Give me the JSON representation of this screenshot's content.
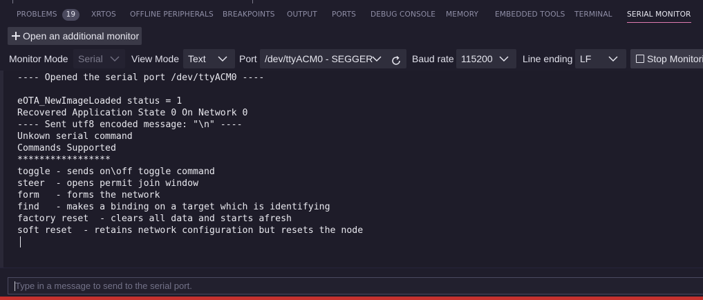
{
  "tabs": [
    {
      "label": "PROBLEMS",
      "badge": "19"
    },
    {
      "label": "XRTOS"
    },
    {
      "label": "OFFLINE PERIPHERALS"
    },
    {
      "label": "BREAKPOINTS"
    },
    {
      "label": "OUTPUT"
    },
    {
      "label": "PORTS"
    },
    {
      "label": "DEBUG CONSOLE"
    },
    {
      "label": "MEMORY"
    },
    {
      "label": "EMBEDDED TOOLS"
    },
    {
      "label": "TERMINAL"
    },
    {
      "label": "SERIAL MONITOR",
      "active": true
    }
  ],
  "open_monitor_label": "Open an additional monitor",
  "controls": {
    "monitor_mode_label": "Monitor Mode",
    "monitor_mode_value": "Serial",
    "view_mode_label": "View Mode",
    "view_mode_value": "Text",
    "port_label": "Port",
    "port_value": "/dev/ttyACM0 - SEGGER",
    "baud_rate_label": "Baud rate",
    "baud_rate_value": "115200",
    "line_ending_label": "Line ending",
    "line_ending_value": "LF",
    "stop_label": "Stop Monitoring"
  },
  "output_lines": [
    "---- Opened the serial port /dev/ttyACM0 ----",
    "",
    "eOTA_NewImageLoaded status = 1",
    "Recovered Application State 0 On Network 0",
    "---- Sent utf8 encoded message: \"\\n\" ----",
    "Unkown serial command",
    "Commands Supported",
    "*****************",
    "toggle - sends on\\off toggle command",
    "steer  - opens permit join window",
    "form   - forms the network",
    "find   - makes a binding on a target which is identifying",
    "factory reset  - clears all data and starts afresh",
    "soft reset  - retains network configuration but resets the node"
  ],
  "message_input": {
    "placeholder": "Type in a message to send to the serial port.",
    "value": ""
  },
  "colors": {
    "active_tab_underline": "#e07bb0",
    "status_bar": "#c5312e"
  }
}
